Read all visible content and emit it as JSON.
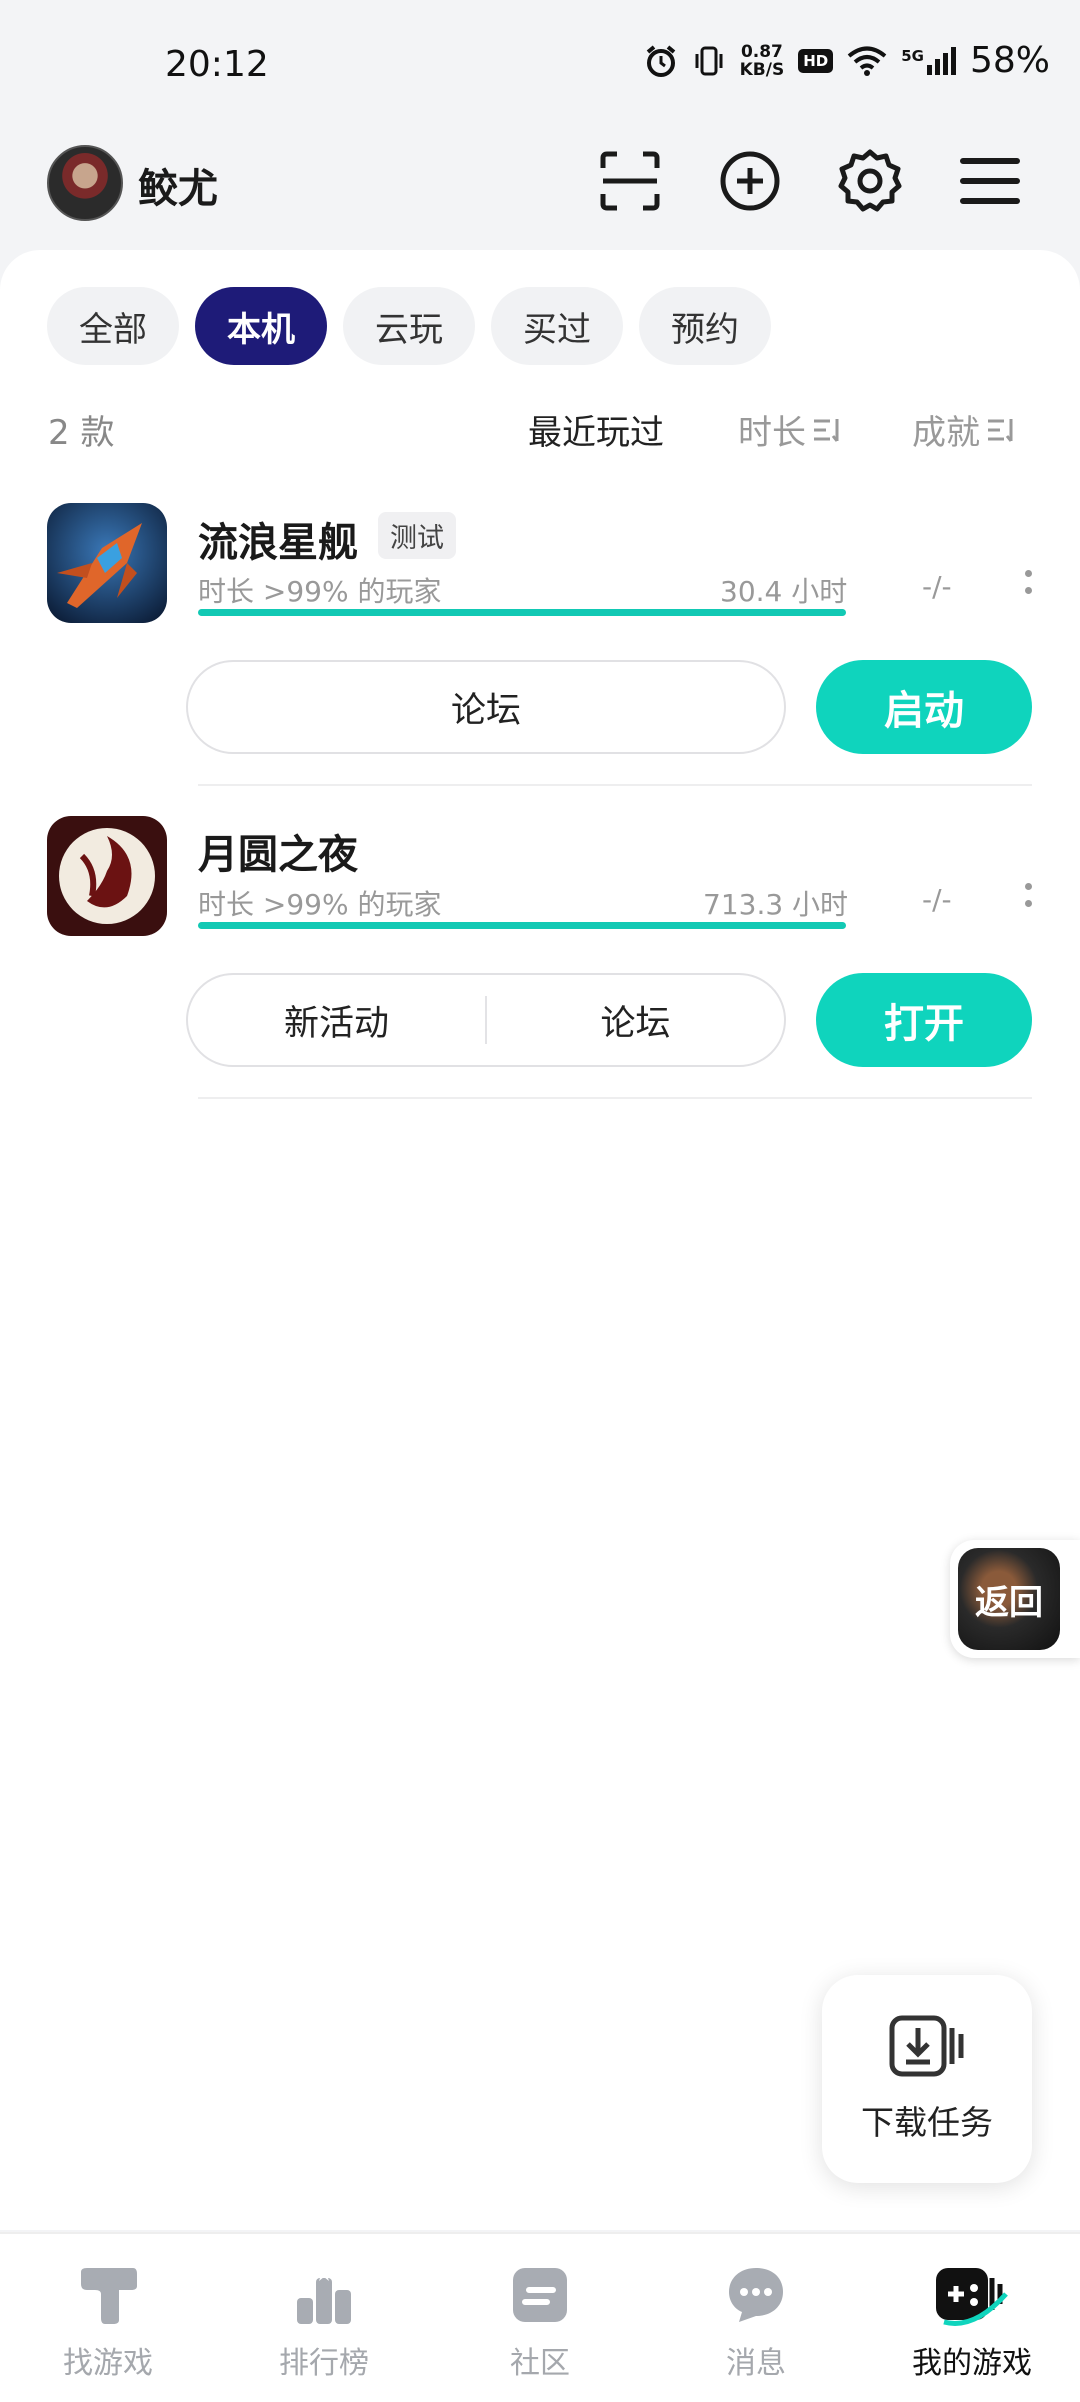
{
  "status_bar": {
    "time": "20:12",
    "net_speed_value": "0.87",
    "net_speed_unit": "KB/S",
    "hd": "HD",
    "network": "5G",
    "battery": "58%"
  },
  "header": {
    "username": "鲛尤",
    "icons": [
      "scan-icon",
      "add-circle-icon",
      "settings-gear-icon",
      "menu-icon"
    ]
  },
  "filters": {
    "chips": [
      "全部",
      "本机",
      "云玩",
      "买过",
      "预约"
    ],
    "active": "本机"
  },
  "list_header": {
    "count": "2 款",
    "sort_recent": "最近玩过",
    "sort_duration": "时长",
    "sort_achievement": "成就"
  },
  "games": [
    {
      "title": "流浪星舰",
      "tag": "测试",
      "subtitle": "时长 >99% 的玩家",
      "hours": "30.4 小时",
      "achievement": "-/-",
      "progress": 1.0,
      "secondary_buttons": [
        "论坛"
      ],
      "primary_button": "启动"
    },
    {
      "title": "月圆之夜",
      "subtitle": "时长 >99% 的玩家",
      "hours": "713.3 小时",
      "achievement": "-/-",
      "progress": 1.0,
      "secondary_buttons": [
        "新活动",
        "论坛"
      ],
      "primary_button": "打开"
    }
  ],
  "floating": {
    "return_label": "返回",
    "download_label": "下载任务"
  },
  "bottom_nav": {
    "items": [
      "找游戏",
      "排行榜",
      "社区",
      "消息",
      "我的游戏"
    ],
    "active": "我的游戏"
  },
  "colors": {
    "accent": "#0fd4bd",
    "chip_active": "#1e1b78",
    "progress": "#12c9b4"
  }
}
